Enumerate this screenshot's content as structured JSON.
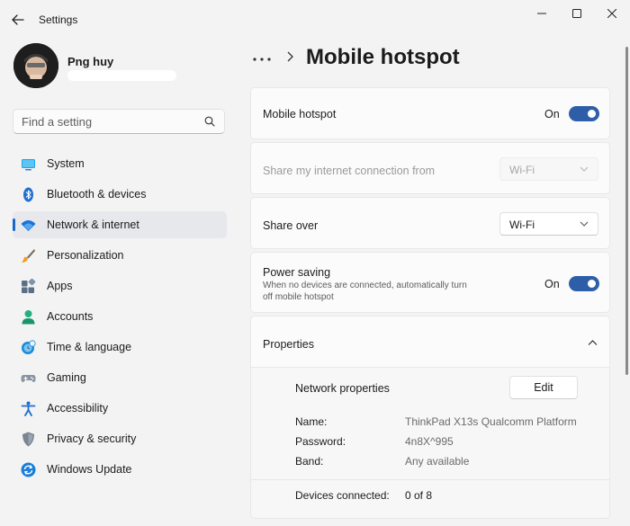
{
  "app": {
    "title": "Settings"
  },
  "user": {
    "name": "Png huy"
  },
  "search": {
    "placeholder": "Find a setting"
  },
  "sidebar": {
    "items": [
      {
        "label": "System",
        "icon": "monitor-icon"
      },
      {
        "label": "Bluetooth & devices",
        "icon": "bluetooth-icon"
      },
      {
        "label": "Network & internet",
        "icon": "wifi-icon",
        "active": true
      },
      {
        "label": "Personalization",
        "icon": "brush-icon"
      },
      {
        "label": "Apps",
        "icon": "apps-icon"
      },
      {
        "label": "Accounts",
        "icon": "person-icon"
      },
      {
        "label": "Time & language",
        "icon": "globe-clock-icon"
      },
      {
        "label": "Gaming",
        "icon": "gamepad-icon"
      },
      {
        "label": "Accessibility",
        "icon": "accessibility-icon"
      },
      {
        "label": "Privacy & security",
        "icon": "shield-icon"
      },
      {
        "label": "Windows Update",
        "icon": "update-icon"
      }
    ]
  },
  "breadcrumb": {
    "title": "Mobile hotspot"
  },
  "hotspot": {
    "label": "Mobile hotspot",
    "state": "On"
  },
  "share_from": {
    "label": "Share my internet connection from",
    "value": "Wi-Fi"
  },
  "share_over": {
    "label": "Share over",
    "value": "Wi-Fi"
  },
  "power_saving": {
    "label": "Power saving",
    "description": "When no devices are connected, automatically turn off mobile hotspot",
    "state": "On"
  },
  "properties": {
    "header": "Properties",
    "network_properties_label": "Network properties",
    "edit_label": "Edit",
    "name_label": "Name:",
    "name_value": "ThinkPad X13s Qualcomm Platform",
    "password_label": "Password:",
    "password_value": "4n8X^995",
    "band_label": "Band:",
    "band_value": "Any available",
    "devices_label": "Devices connected:",
    "devices_value": "0 of 8"
  },
  "colors": {
    "accent": "#2f5ea9",
    "active_marker": "#1b66c9"
  }
}
